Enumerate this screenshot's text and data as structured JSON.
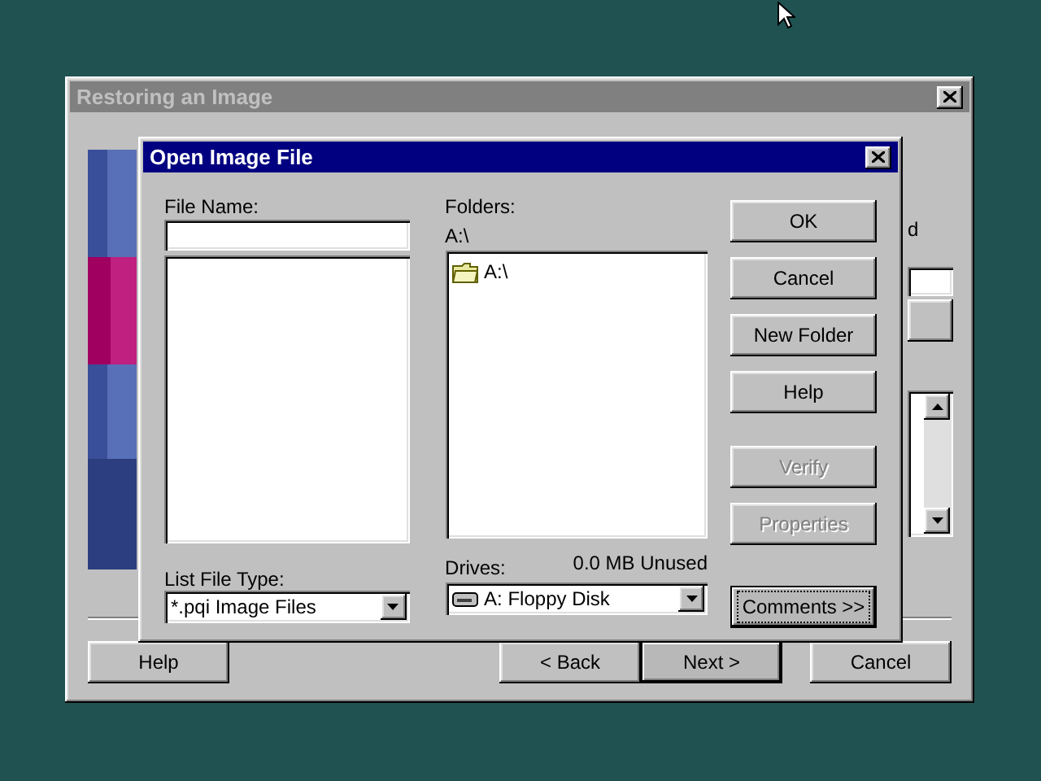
{
  "back_window": {
    "title": "Restoring an Image",
    "active": false,
    "fragment": "d",
    "buttons": [
      {
        "label": "Help",
        "default": false
      },
      {
        "label": "< Back",
        "default": false
      },
      {
        "label": "Next >",
        "default": true
      },
      {
        "label": "Cancel",
        "default": false
      }
    ]
  },
  "dialog": {
    "title": "Open Image File",
    "active": true,
    "file_name": {
      "label": "File Name:"
    },
    "folders": {
      "label": "Folders:",
      "path": "A:\\",
      "tree": [
        {
          "label": "A:\\"
        }
      ]
    },
    "list_file_type": {
      "label": "List File Type:",
      "value": "*.pqi  Image Files"
    },
    "drives": {
      "label": "Drives:",
      "free_space": "0.0 MB Unused",
      "value": "A:  Floppy Disk"
    },
    "buttons": [
      {
        "label": "OK",
        "disabled": false,
        "focused": false
      },
      {
        "label": "Cancel",
        "disabled": false,
        "focused": false
      },
      {
        "label": "New Folder",
        "disabled": false,
        "focused": false
      },
      {
        "label": "Help",
        "disabled": false,
        "focused": false
      },
      {
        "label": "Verify",
        "disabled": true,
        "focused": false
      },
      {
        "label": "Properties",
        "disabled": true,
        "focused": false
      },
      {
        "label": "Comments >>",
        "disabled": false,
        "focused": true
      }
    ]
  }
}
